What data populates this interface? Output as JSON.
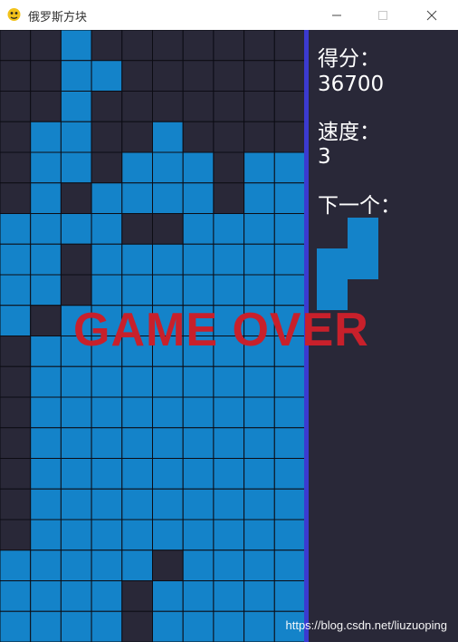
{
  "window": {
    "title": "俄罗斯方块"
  },
  "colors": {
    "background": "#292838",
    "block": "#1483c9",
    "grid_line": "#0c0c14",
    "divider": "#3b3ad0",
    "game_over": "#c8202b"
  },
  "board": {
    "rows": [
      "0010000000",
      "0011000000",
      "0010000000",
      "0110010000",
      "0110111011",
      "0101111011",
      "1111001111",
      "1101111111",
      "1101111111",
      "1011111111",
      "0111111111",
      "0111111111",
      "0111111111",
      "0111111111",
      "0111111111",
      "0111111111",
      "0111111111",
      "1111101111",
      "1111011111",
      "1111011111"
    ]
  },
  "panel": {
    "score_label": "得分：",
    "score_value": "36700",
    "speed_label": "速度：",
    "speed_value": "3",
    "next_label": "下一个："
  },
  "next_piece": {
    "name": "S-vertical",
    "rows": [
      "01",
      "11",
      "10"
    ]
  },
  "overlay": {
    "text": "GAME OVER"
  },
  "watermark": "https://blog.csdn.net/liuzuoping"
}
